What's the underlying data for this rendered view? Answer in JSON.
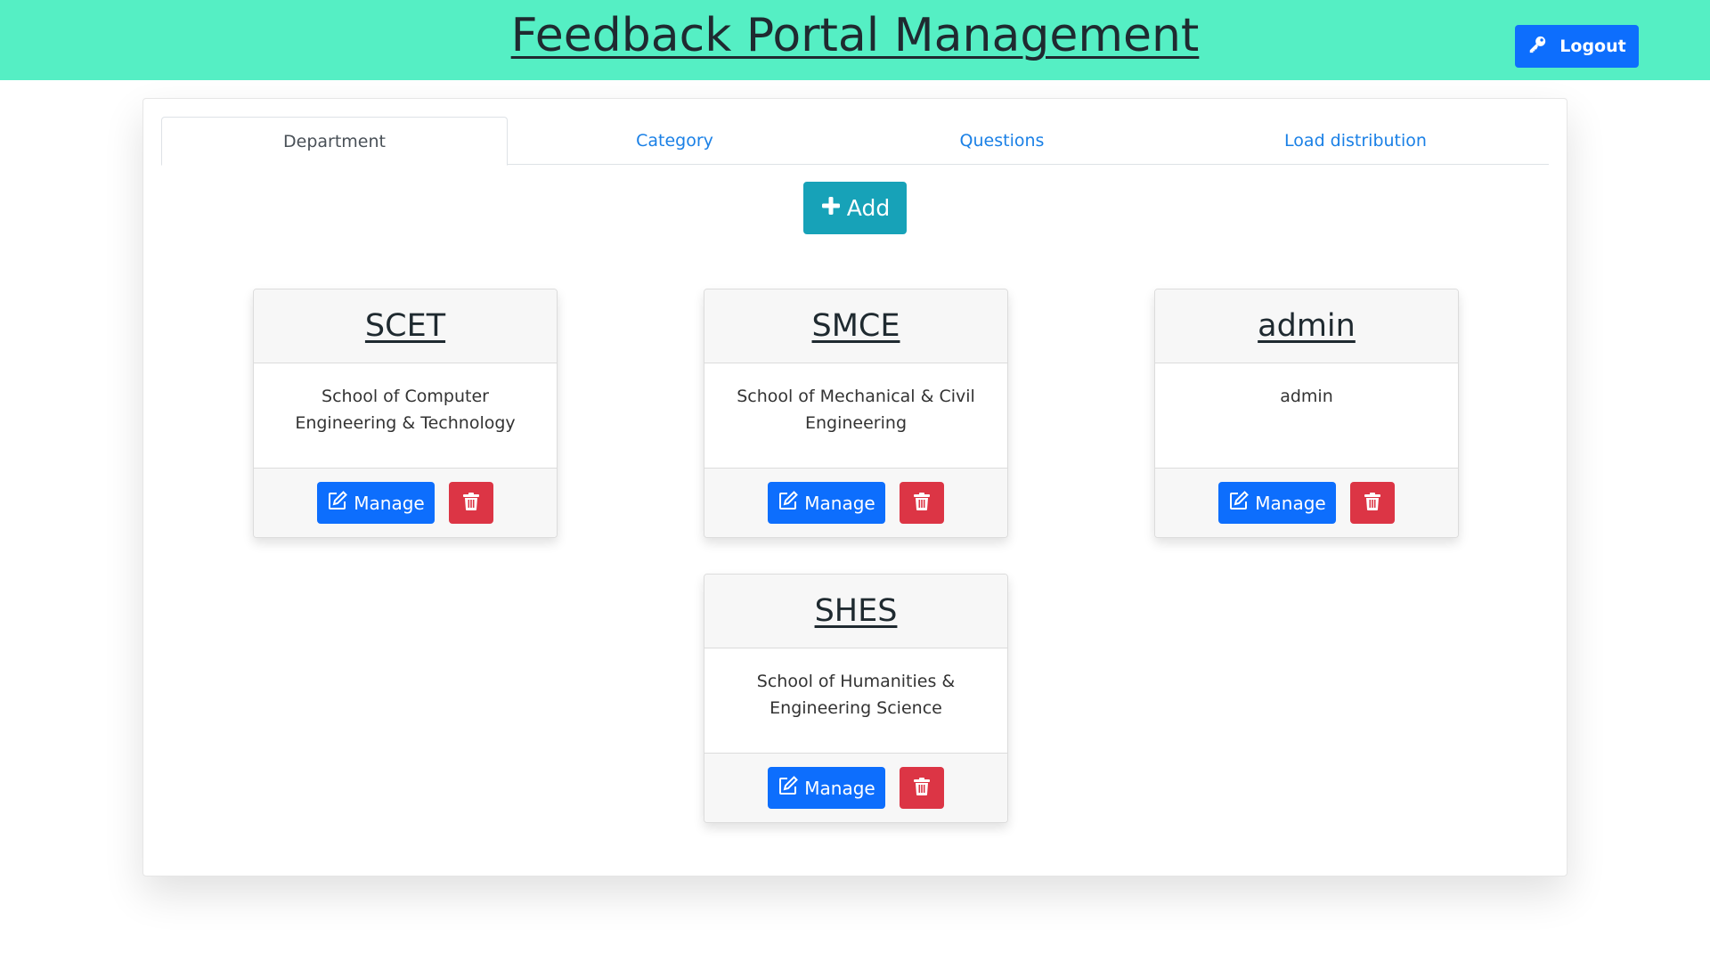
{
  "header": {
    "title": "Feedback Portal Management",
    "logout_label": "Logout",
    "logout_icon": "key-icon",
    "background_color": "#55efc4"
  },
  "tabs": [
    {
      "label": "Department",
      "active": true
    },
    {
      "label": "Category",
      "active": false
    },
    {
      "label": "Questions",
      "active": false
    },
    {
      "label": "Load distribution",
      "active": false
    }
  ],
  "add_button": {
    "label": "Add",
    "icon": "plus-icon",
    "color": "#17a2b8"
  },
  "departments": [
    {
      "code": "SCET",
      "name": "School of Computer Engineering & Technology",
      "manage_label": "Manage"
    },
    {
      "code": "SMCE",
      "name": "School of Mechanical & Civil Engineering",
      "manage_label": "Manage"
    },
    {
      "code": "admin",
      "name": "admin",
      "manage_label": "Manage"
    },
    {
      "code": "SHES",
      "name": "School of Humanities & Engineering Science",
      "manage_label": "Manage"
    }
  ],
  "colors": {
    "primary": "#0d6efd",
    "danger": "#dc3545",
    "tab_link": "#1a80e6"
  }
}
